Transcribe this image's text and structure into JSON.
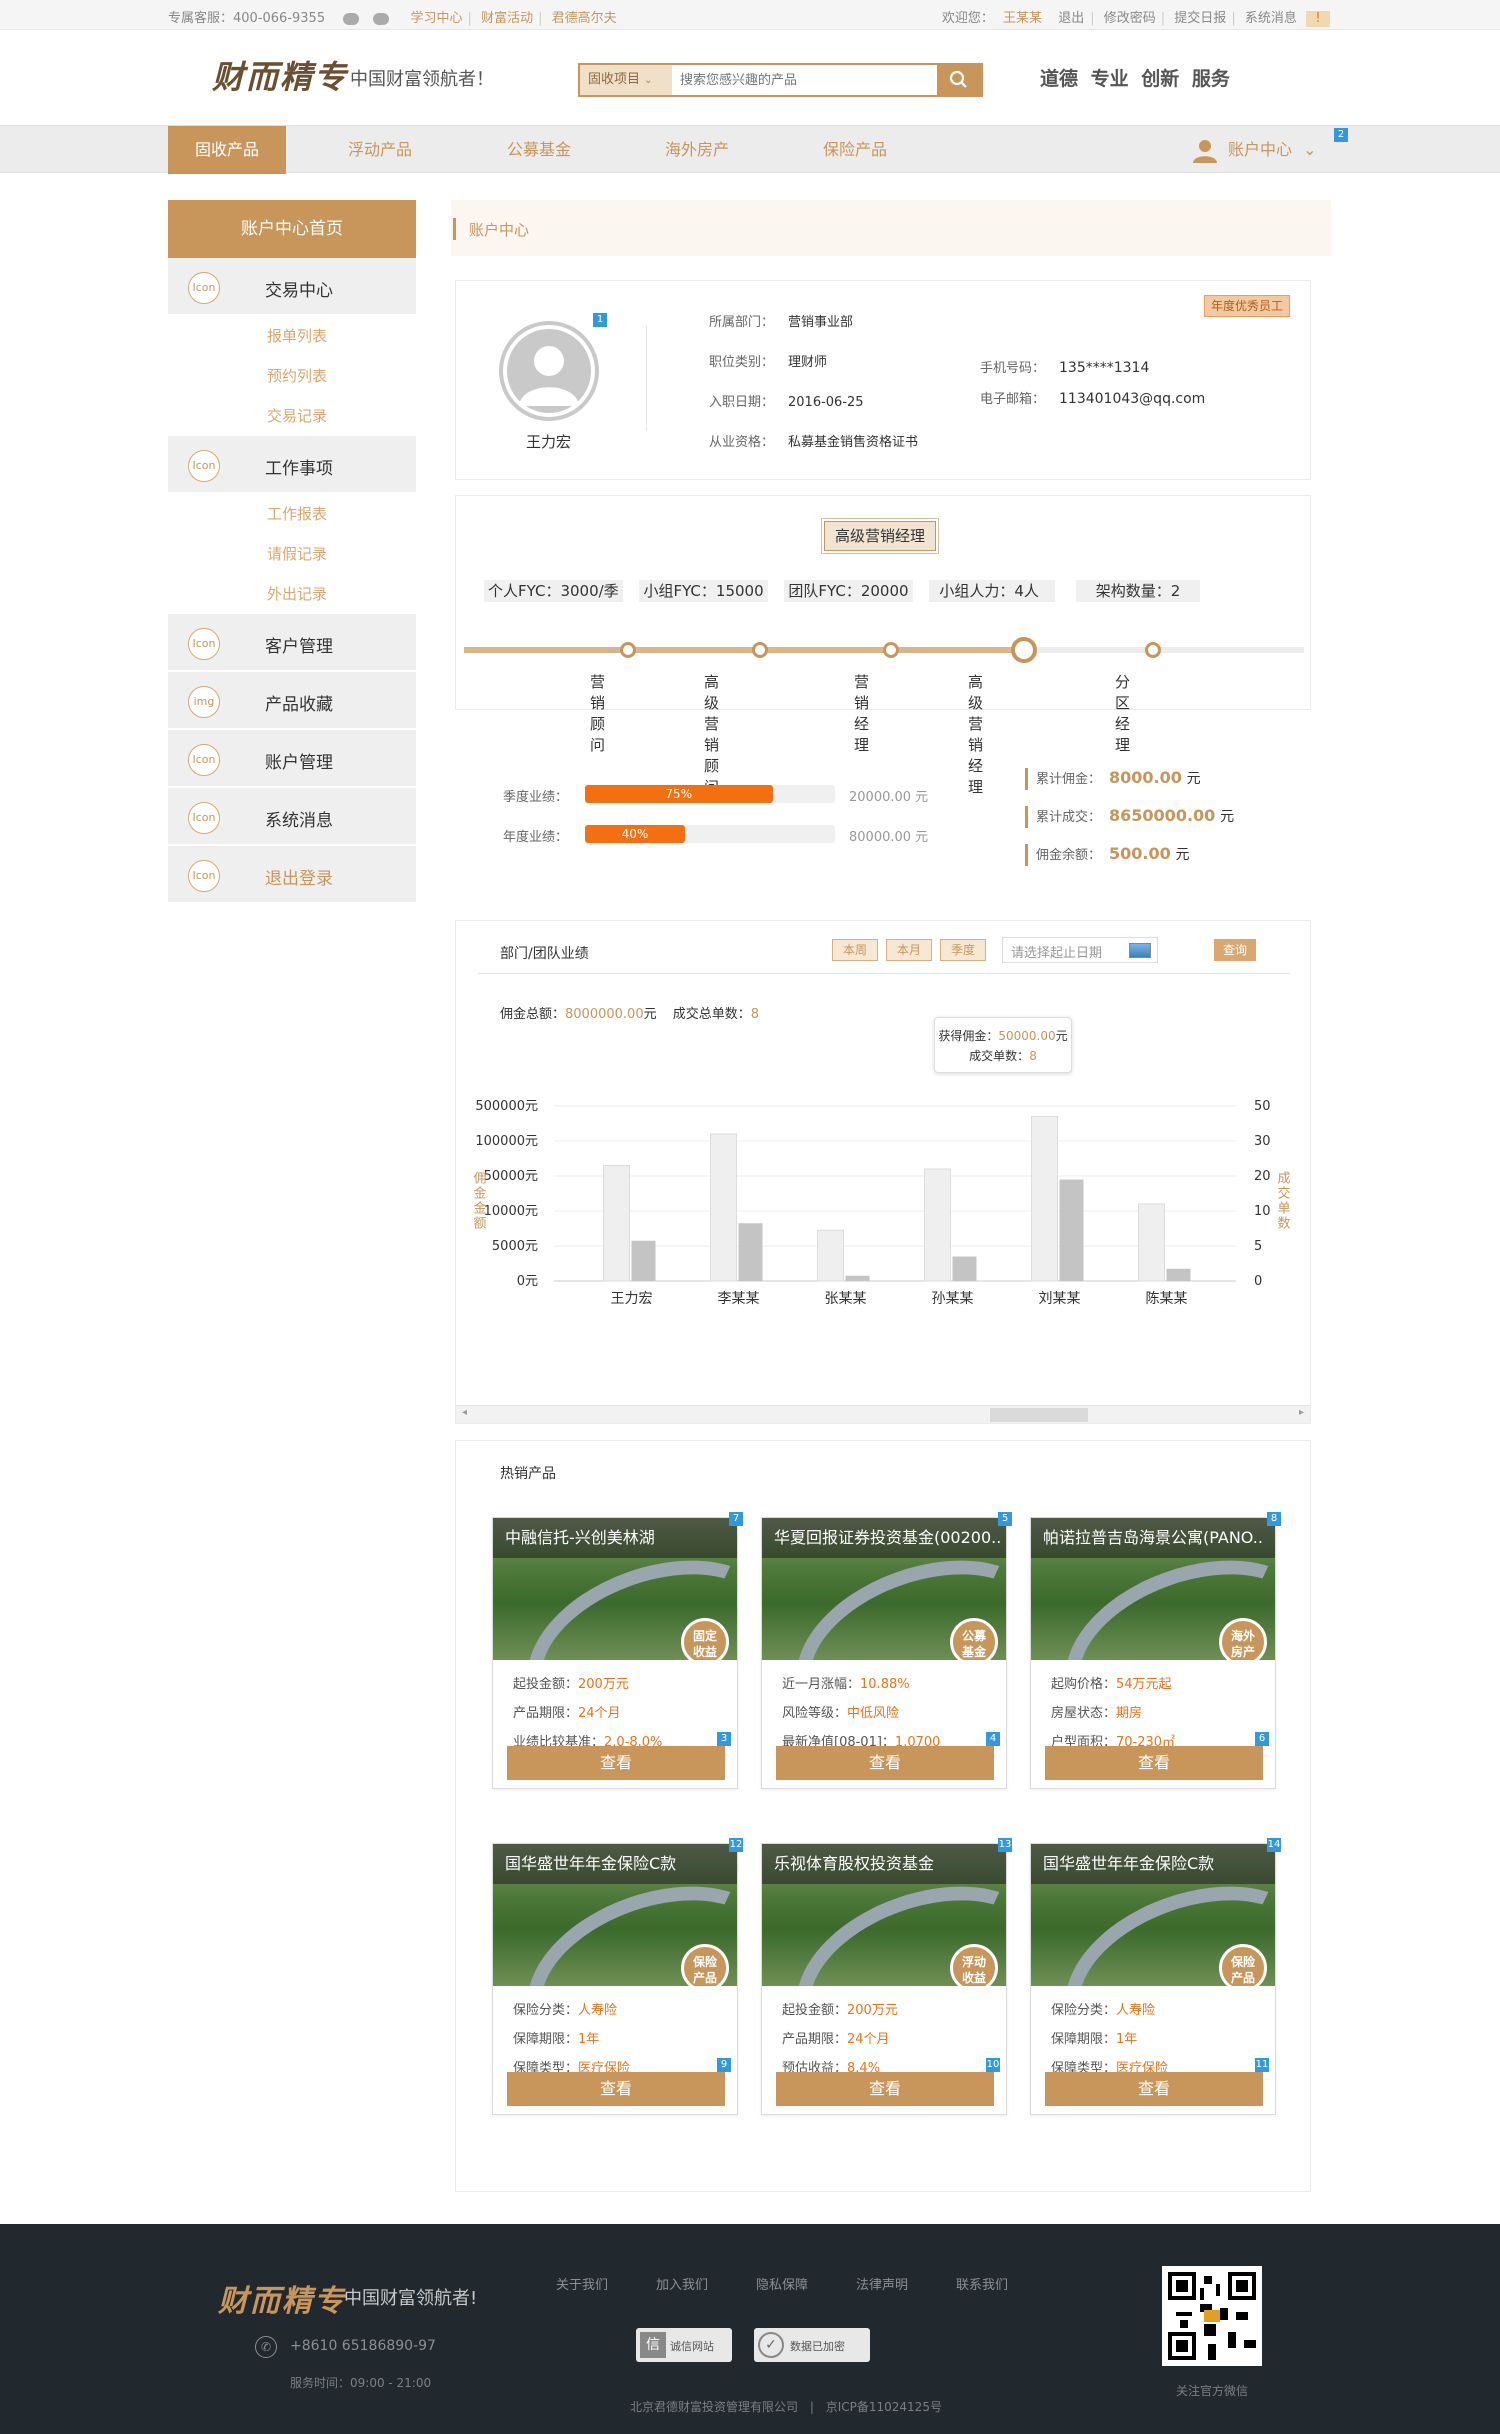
{
  "topbar": {
    "hotline": "专属客服：400-066-9355",
    "links": [
      "学习中心",
      "财富活动",
      "君德高尔夫"
    ],
    "welcome": "欢迎您：",
    "user": "王某某",
    "logout": "退出",
    "change_pwd": "修改密码",
    "daily": "提交日报",
    "sysmsg": "系统消息",
    "msg_badge": "!"
  },
  "header": {
    "logo": "财而精专",
    "slogan": "中国财富领航者！",
    "search_select": "固收项目",
    "search_placeholder": "搜索您感兴趣的产品",
    "values": "道德 专业 创新 服务"
  },
  "nav": {
    "items": [
      "固收产品",
      "浮动产品",
      "公募基金",
      "海外房产",
      "保险产品"
    ],
    "account": "账户中心",
    "account_badge": "2"
  },
  "sidebar": {
    "head": "账户中心首页",
    "sections": [
      {
        "icon": "Icon",
        "title": "交易中心",
        "subs": [
          "报单列表",
          "预约列表",
          "交易记录"
        ]
      },
      {
        "icon": "Icon",
        "title": "工作事项",
        "subs": [
          "工作报表",
          "请假记录",
          "外出记录"
        ]
      },
      {
        "icon": "Icon",
        "title": "客户管理",
        "subs": []
      },
      {
        "icon": "img",
        "title": "产品收藏",
        "subs": []
      },
      {
        "icon": "Icon",
        "title": "账户管理",
        "subs": []
      },
      {
        "icon": "Icon",
        "title": "系统消息",
        "subs": []
      },
      {
        "icon": "Icon",
        "title": "退出登录",
        "subs": []
      }
    ]
  },
  "main": {
    "breadcrumb": "账户中心",
    "profile": {
      "name": "王力宏",
      "badge": "1",
      "award": "年度优秀员工",
      "fields": [
        {
          "label": "所属部门：",
          "value": "营销事业部"
        },
        {
          "label": "职位类别：",
          "value": "理财师"
        },
        {
          "label": "入职日期：",
          "value": "2016-06-25"
        },
        {
          "label": "从业资格：",
          "value": "私募基金销售资格证书"
        }
      ],
      "phone_label": "手机号码：",
      "phone": "135****1314",
      "email_label": "电子邮箱：",
      "email": "113401043@qq.com"
    },
    "rank": {
      "current": "高级营销经理",
      "stats": [
        "个人FYC：3000/季",
        "小组FYC：15000",
        "团队FYC：20000",
        "小组人力：4人",
        "架构数量：2"
      ],
      "levels": [
        "营销顾问",
        "高级营销顾问",
        "营销经理",
        "高级营销经理",
        "分区经理"
      ],
      "current_index": 3
    },
    "performance": {
      "quarter_label": "季度业绩：",
      "quarter_pct": "75%",
      "quarter_pct_value": 0.75,
      "quarter_target": "20000.00 元",
      "year_label": "年度业绩：",
      "year_pct": "40%",
      "year_pct_value": 0.4,
      "year_target": "80000.00 元",
      "totals": [
        {
          "label": "累计佣金：",
          "value": "8000.00",
          "unit": "元"
        },
        {
          "label": "累计成交：",
          "value": "8650000.00",
          "unit": "元"
        },
        {
          "label": "佣金余额：",
          "value": "500.00",
          "unit": "元"
        }
      ]
    },
    "team": {
      "title": "部门/团队业绩",
      "btns": [
        "本周",
        "本月",
        "季度"
      ],
      "date_placeholder": "请选择起止日期",
      "query": "查询",
      "summary_label1": "佣金总额：",
      "summary_val1": "8000000.00",
      "summary_unit1": "元",
      "summary_label2": "成交总单数：",
      "summary_val2": "8",
      "tooltip_l1": "获得佣金：",
      "tooltip_v1": "50000.00",
      "tooltip_u1": "元",
      "tooltip_l2": "成交单数：",
      "tooltip_v2": "8"
    },
    "hot_title": "热销产品",
    "products": [
      {
        "title": "中融信托-兴创美林湖",
        "tag": [
          "固定",
          "收益"
        ],
        "corner": "7",
        "btn_badge": "3",
        "pct": "60%",
        "rows": [
          [
            "起投金额：",
            "200万元"
          ],
          [
            "产品期限：",
            "24个月"
          ],
          [
            "业绩比较基准：",
            "2.0-8.0%"
          ]
        ],
        "btn": "查看"
      },
      {
        "title": "华夏回报证券投资基金(00200..",
        "tag": [
          "公募",
          "基金"
        ],
        "corner": "5",
        "btn_badge": "4",
        "pct": "60%",
        "rows": [
          [
            "近一月涨幅：",
            "10.88%"
          ],
          [
            "风险等级：",
            "中低风险"
          ],
          [
            "最新净值[08-01]：",
            "1.0700"
          ]
        ],
        "btn": "查看"
      },
      {
        "title": "帕诺拉普吉岛海景公寓(PANO..",
        "tag": [
          "海外",
          "房产"
        ],
        "corner": "8",
        "btn_badge": "6",
        "pct": "",
        "rows": [
          [
            "起购价格：",
            "54万元起"
          ],
          [
            "房屋状态：",
            "期房"
          ],
          [
            "户型面积：",
            "70-230㎡"
          ]
        ],
        "btn": "查看"
      },
      {
        "title": "国华盛世年年金保险C款",
        "tag": [
          "保险",
          "产品"
        ],
        "corner": "12",
        "btn_badge": "9",
        "pct": "",
        "rows": [
          [
            "保险分类：",
            "人寿险"
          ],
          [
            "保障期限：",
            "1年"
          ],
          [
            "保障类型：",
            "医疗保险"
          ]
        ],
        "btn": "查看"
      },
      {
        "title": "乐视体育股权投资基金",
        "tag": [
          "浮动",
          "收益"
        ],
        "corner": "13",
        "btn_badge": "10",
        "pct": "",
        "rows": [
          [
            "起投金额：",
            "200万元"
          ],
          [
            "产品期限：",
            "24个月"
          ],
          [
            "预估收益：",
            "8.4%"
          ]
        ],
        "btn": "查看"
      },
      {
        "title": "国华盛世年年金保险C款",
        "tag": [
          "保险",
          "产品"
        ],
        "corner": "14",
        "btn_badge": "11",
        "pct": "",
        "rows": [
          [
            "保险分类：",
            "人寿险"
          ],
          [
            "保障期限：",
            "1年"
          ],
          [
            "保障类型：",
            "医疗保险"
          ]
        ],
        "btn": "查看"
      }
    ]
  },
  "chart_data": {
    "type": "bar",
    "categories": [
      "王力宏",
      "李某某",
      "张某某",
      "孙某某",
      "刘某某",
      "陈某某"
    ],
    "ylabel": "佣金金额",
    "y2label": "成交单数",
    "yticks": [
      "500000元",
      "100000元",
      "50000元",
      "10000元",
      "5000元",
      "0元"
    ],
    "y2ticks": [
      "50",
      "30",
      "20",
      "10",
      "5",
      "0"
    ],
    "series": [
      {
        "name": "佣金金额",
        "values": [
          3.3,
          4.2,
          1.45,
          3.2,
          4.7,
          2.2
        ]
      },
      {
        "name": "成交单数",
        "values": [
          1.15,
          1.65,
          0.15,
          0.7,
          2.9,
          0.35
        ]
      }
    ],
    "ylim": [
      0,
      5
    ]
  },
  "footer": {
    "logo": "财而精专",
    "slogan": "中国财富领航者!",
    "links": [
      "关于我们",
      "加入我们",
      "隐私保障",
      "法律声明",
      "联系我们"
    ],
    "phone": "+8610 65186890-97",
    "hours": "服务时间：09:00 - 21:00",
    "badge1": "诚信网站",
    "badge2": "数据已加密",
    "copyright": "北京君德财富投资管理有限公司",
    "icp": "京ICP备11024125号",
    "qr_label": "关注官方微信"
  },
  "colors": {
    "accent": "#c8965a",
    "orange": "#e8741a",
    "footer": "#22292e"
  }
}
